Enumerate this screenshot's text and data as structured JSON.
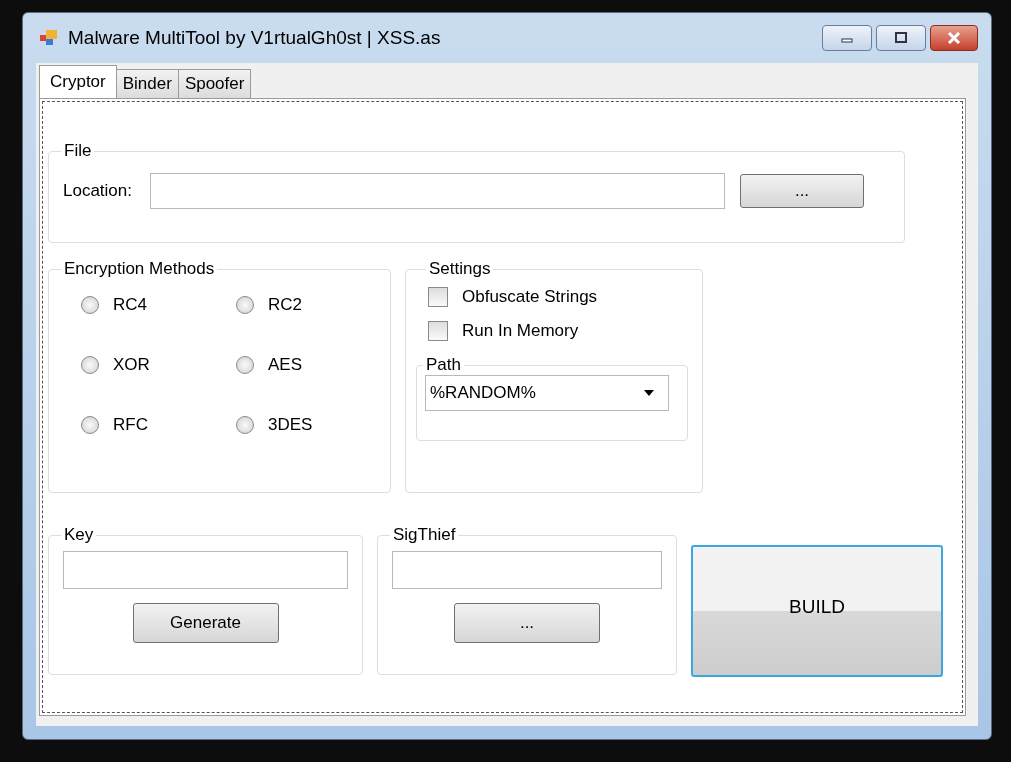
{
  "window": {
    "title": "Malware MultiTool by V1rtualGh0st | XSS.as"
  },
  "tabs": [
    {
      "label": "Cryptor",
      "selected": true
    },
    {
      "label": "Binder",
      "selected": false
    },
    {
      "label": "Spoofer",
      "selected": false
    }
  ],
  "file": {
    "title": "File",
    "label": "Location:",
    "browse": "..."
  },
  "encryption": {
    "title": "Encryption Methods",
    "options": [
      {
        "label": "RC4",
        "selected": false
      },
      {
        "label": "RC2",
        "selected": false
      },
      {
        "label": "XOR",
        "selected": false
      },
      {
        "label": "AES",
        "selected": false
      },
      {
        "label": "RFC",
        "selected": false
      },
      {
        "label": "3DES",
        "selected": false
      }
    ]
  },
  "settings": {
    "title": "Settings",
    "options": [
      {
        "label": "Obfuscate Strings",
        "checked": false
      },
      {
        "label": "Run In Memory",
        "checked": false
      }
    ],
    "path": {
      "title": "Path",
      "value": "%RANDOM%"
    }
  },
  "key": {
    "title": "Key",
    "button": "Generate"
  },
  "sigthief": {
    "title": "SigThief",
    "button": "..."
  },
  "build": "BUILD"
}
